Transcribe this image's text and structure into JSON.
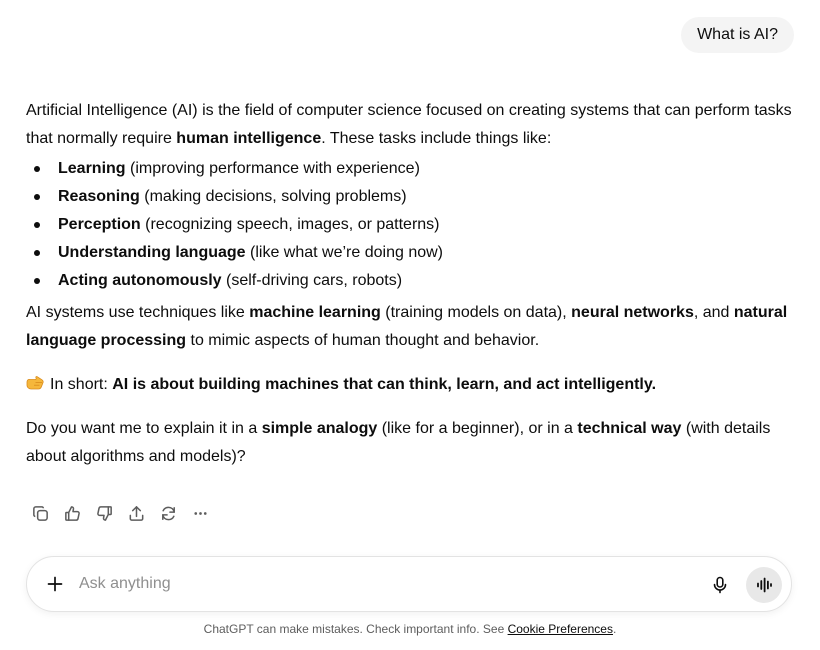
{
  "user_message": {
    "text": "What is AI?"
  },
  "assistant": {
    "intro": {
      "part1": "Artificial Intelligence (AI) is the field of computer science focused on creating systems that can perform tasks that normally require ",
      "bold1": "human intelligence",
      "part2": ". These tasks include things like:"
    },
    "bullets": [
      {
        "term": "Learning",
        "detail": " (improving performance with experience)"
      },
      {
        "term": "Reasoning",
        "detail": " (making decisions, solving problems)"
      },
      {
        "term": "Perception",
        "detail": " (recognizing speech, images, or patterns)"
      },
      {
        "term": "Understanding language",
        "detail": " (like what we’re doing now)"
      },
      {
        "term": "Acting autonomously",
        "detail": " (self-driving cars, robots)"
      }
    ],
    "techniques": {
      "part1": "AI systems use techniques like ",
      "bold1": "machine learning",
      "part2": " (training models on data), ",
      "bold2": "neural networks",
      "part3": ", and ",
      "bold3": "natural language processing",
      "part4": " to mimic aspects of human thought and behavior."
    },
    "summary": {
      "icon": "pointing-hand-emoji",
      "prefix": "In short: ",
      "bold": "AI is about building machines that can think, learn, and act intelligently."
    },
    "question": {
      "part1": "Do you want me to explain it in a ",
      "bold1": "simple analogy",
      "part2": " (like for a beginner), or in a ",
      "bold2": "technical way",
      "part3": " (with details about algorithms and models)?"
    }
  },
  "actions": [
    {
      "name": "copy",
      "icon": "copy-icon"
    },
    {
      "name": "good-response",
      "icon": "thumbs-up-icon"
    },
    {
      "name": "bad-response",
      "icon": "thumbs-down-icon"
    },
    {
      "name": "share",
      "icon": "share-icon"
    },
    {
      "name": "regenerate",
      "icon": "regenerate-icon"
    },
    {
      "name": "more",
      "icon": "more-icon"
    }
  ],
  "composer": {
    "placeholder": "Ask anything",
    "value": ""
  },
  "footer": {
    "text": "ChatGPT can make mistakes. Check important info. See ",
    "link": "Cookie Preferences",
    "end": "."
  },
  "colors": {
    "text": "#0d0d0d",
    "bubble_bg": "#f4f4f4",
    "voice_button_bg": "#e8e8e8",
    "muted": "#5d5d5d"
  }
}
